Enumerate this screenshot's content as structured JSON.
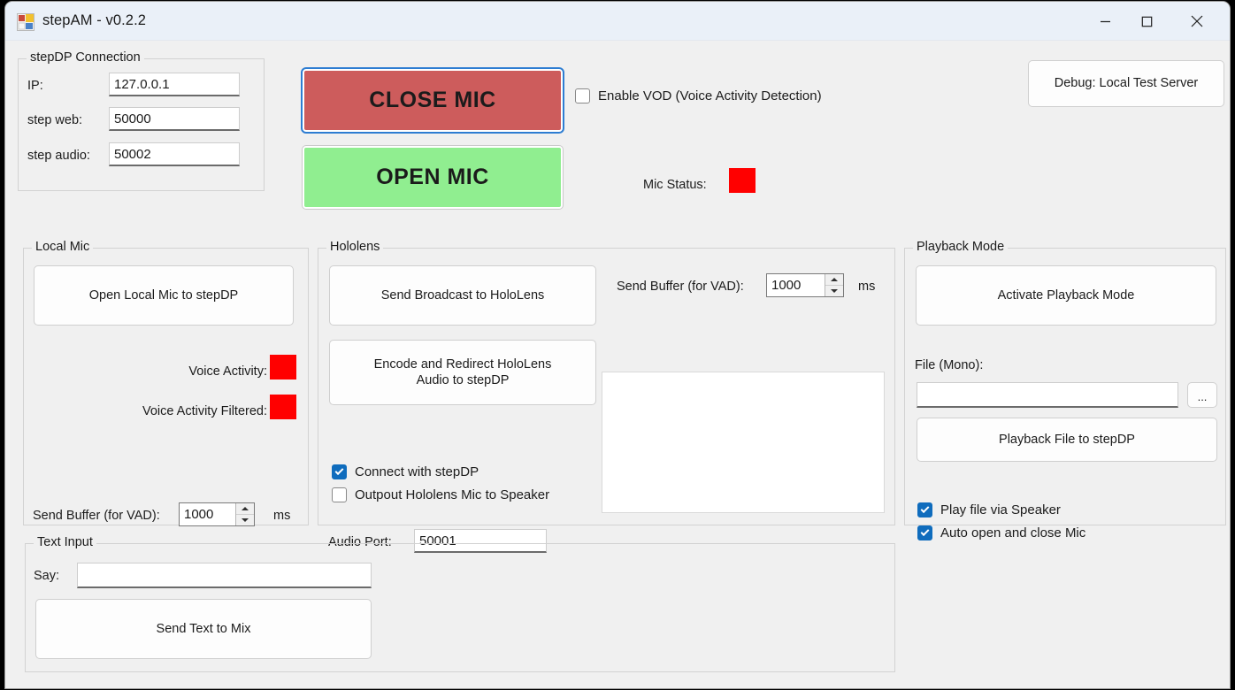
{
  "window": {
    "title": "stepAM - v0.2.2",
    "icon": "app-grid-icon",
    "controls": {
      "minimize": "—",
      "maximize": "□",
      "close": "✕"
    }
  },
  "stepdp_connection": {
    "legend": "stepDP Connection",
    "fields": [
      {
        "label": "IP:",
        "value": "127.0.0.1"
      },
      {
        "label": "step web:",
        "value": "50000"
      },
      {
        "label": "step audio:",
        "value": "50002"
      }
    ]
  },
  "mic_controls": {
    "close_mic_label": "CLOSE MIC",
    "open_mic_label": "OPEN MIC",
    "close_mic_color": "#cd5c5c",
    "open_mic_color": "#90ee90",
    "enable_vod": {
      "label": "Enable VOD (Voice Activity Detection)",
      "checked": false
    },
    "mic_status": {
      "label": "Mic Status:",
      "color": "#ff0000"
    }
  },
  "debug_button": {
    "label": "Debug: Local Test Server"
  },
  "local_mic": {
    "legend": "Local Mic",
    "open_button": "Open Local Mic to stepDP",
    "indicators": [
      {
        "label": "Voice Activity:",
        "color": "#ff0000"
      },
      {
        "label": "Voice Activity Filtered:",
        "color": "#ff0000"
      }
    ],
    "send_buffer": {
      "label": "Send Buffer (for VAD):",
      "value": "1000",
      "unit": "ms"
    }
  },
  "hololens": {
    "legend": "Hololens",
    "broadcast_button": "Send Broadcast to HoloLens",
    "encode_button_line1": "Encode and Redirect HoloLens",
    "encode_button_line2": "Audio to stepDP",
    "checkboxes": [
      {
        "label": "Connect with stepDP",
        "checked": true
      },
      {
        "label": "Outpout Hololens Mic to Speaker",
        "checked": false
      }
    ],
    "audio_port": {
      "label": "Audio Port:",
      "value": "50001"
    },
    "send_buffer": {
      "label": "Send Buffer (for VAD):",
      "value": "1000",
      "unit": "ms"
    },
    "log_panel": ""
  },
  "playback_mode": {
    "legend": "Playback Mode",
    "activate_button": "Activate Playback Mode",
    "file_label": "File (Mono):",
    "file_value": "",
    "browse_button": "...",
    "playback_button": "Playback File to stepDP",
    "checkboxes": [
      {
        "label": "Play file via Speaker",
        "checked": true
      },
      {
        "label": "Auto open and close Mic",
        "checked": true
      }
    ]
  },
  "text_input": {
    "legend": "Text Input",
    "say_label": "Say:",
    "say_value": "",
    "send_button": "Send Text to Mix"
  }
}
